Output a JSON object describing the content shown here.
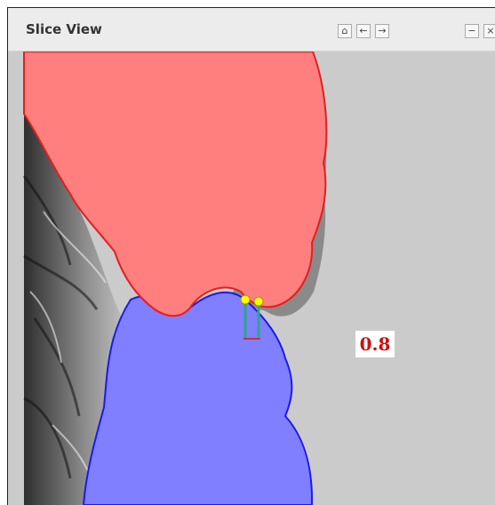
{
  "window": {
    "title": "Slice View",
    "buttons": {
      "home_icon": "home-icon",
      "back_icon": "arrow-left-icon",
      "forward_icon": "arrow-right-icon",
      "minimize_icon": "minimize-icon",
      "close_icon": "close-icon"
    }
  },
  "viewport": {
    "measurement_value": "0.8",
    "colors": {
      "background": "#cbcbcb",
      "upper_region": "#ff7f7f",
      "upper_outline": "#e02020",
      "lower_region": "#7f7fff",
      "lower_outline": "#1a1aee",
      "measure_points": "#ffff00",
      "measure_lines": "#2aa88a",
      "measure_value_text": "#cc1111"
    }
  }
}
